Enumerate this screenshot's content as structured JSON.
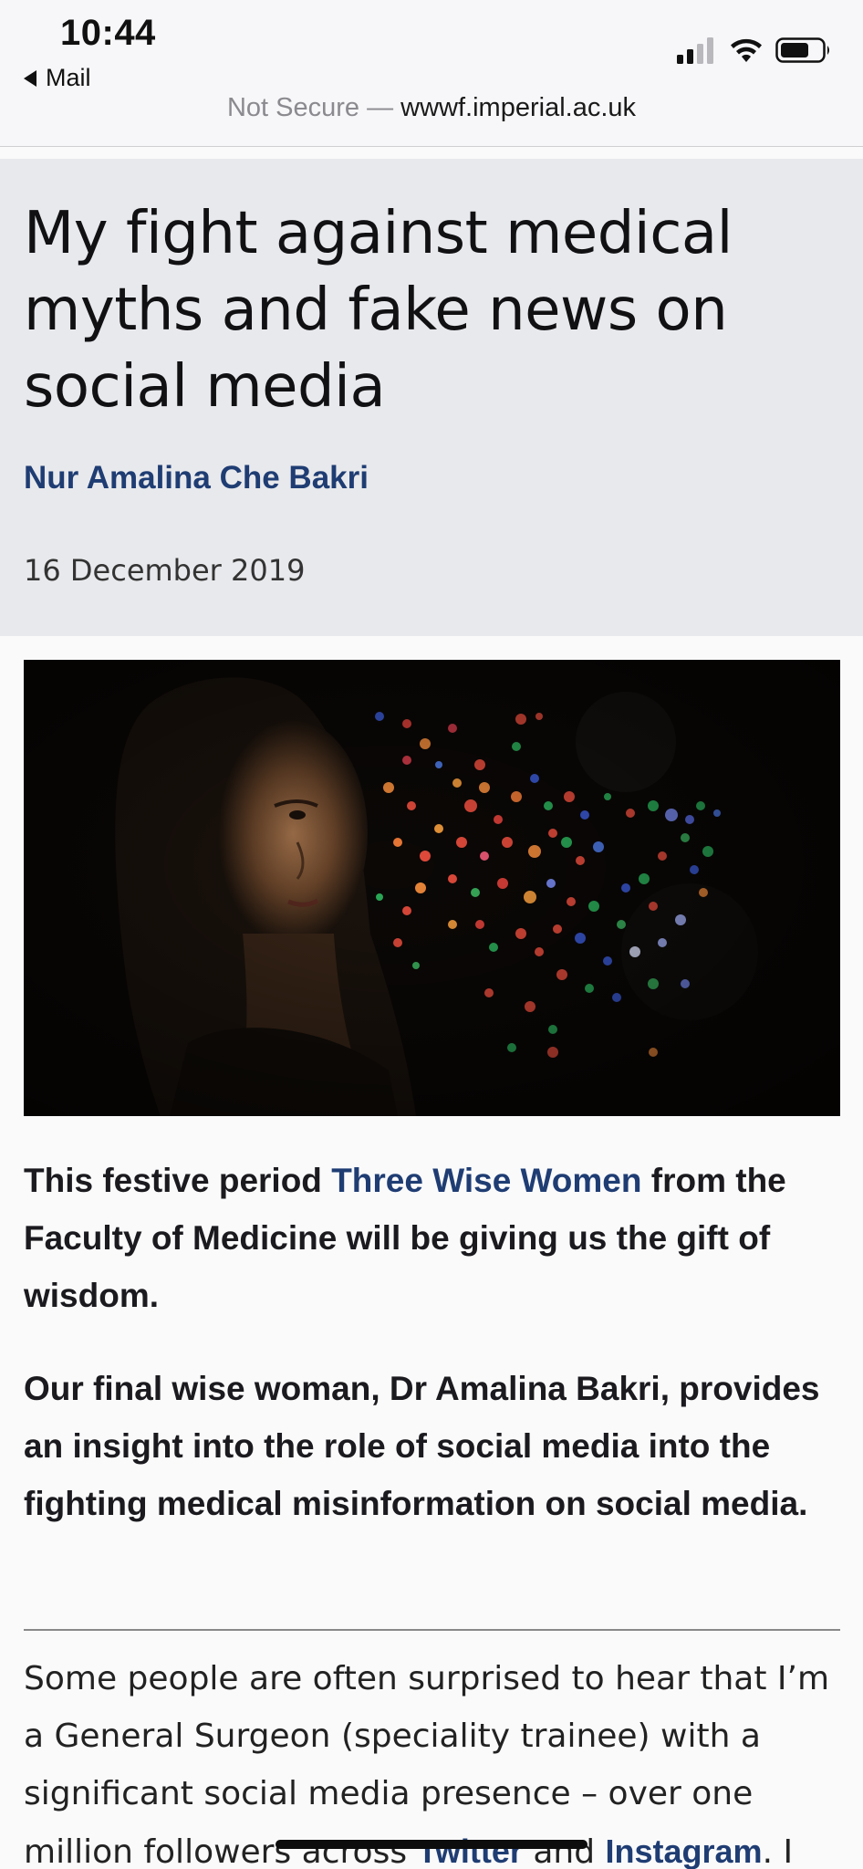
{
  "status_bar": {
    "time": "10:44",
    "back_label": "Mail"
  },
  "browser": {
    "security_label": "Not Secure —",
    "domain": "wwwf.imperial.ac.uk"
  },
  "article": {
    "title": "My fight against medical myths and fake news on social media",
    "author": "Nur Amalina Che Bakri",
    "date": "16 December 2019",
    "lead1": {
      "prefix": "This festive period ",
      "link": "Three Wise Women",
      "suffix": " from the Faculty of Medicine will be giving us the gift of wisdom."
    },
    "lead2": "Our final wise woman, Dr Amalina Bakri, provides an insight into the role of social media into the fighting medical misinformation on social media.",
    "body": {
      "prefix": "Some people are often surprised to hear that I’m a General Surgeon (speciality trainee) with a significant social media presence – over one million followers across ",
      "link1": "Twitter",
      "middle": " and ",
      "link2": "Instagram",
      "suffix": ". I"
    }
  },
  "colors": {
    "link": "#1f3d73",
    "header_bg": "#e8e9ec",
    "page_bg": "#fafafb"
  },
  "icons": [
    "back-arrow-icon",
    "signal-icon",
    "wifi-icon",
    "battery-icon"
  ]
}
